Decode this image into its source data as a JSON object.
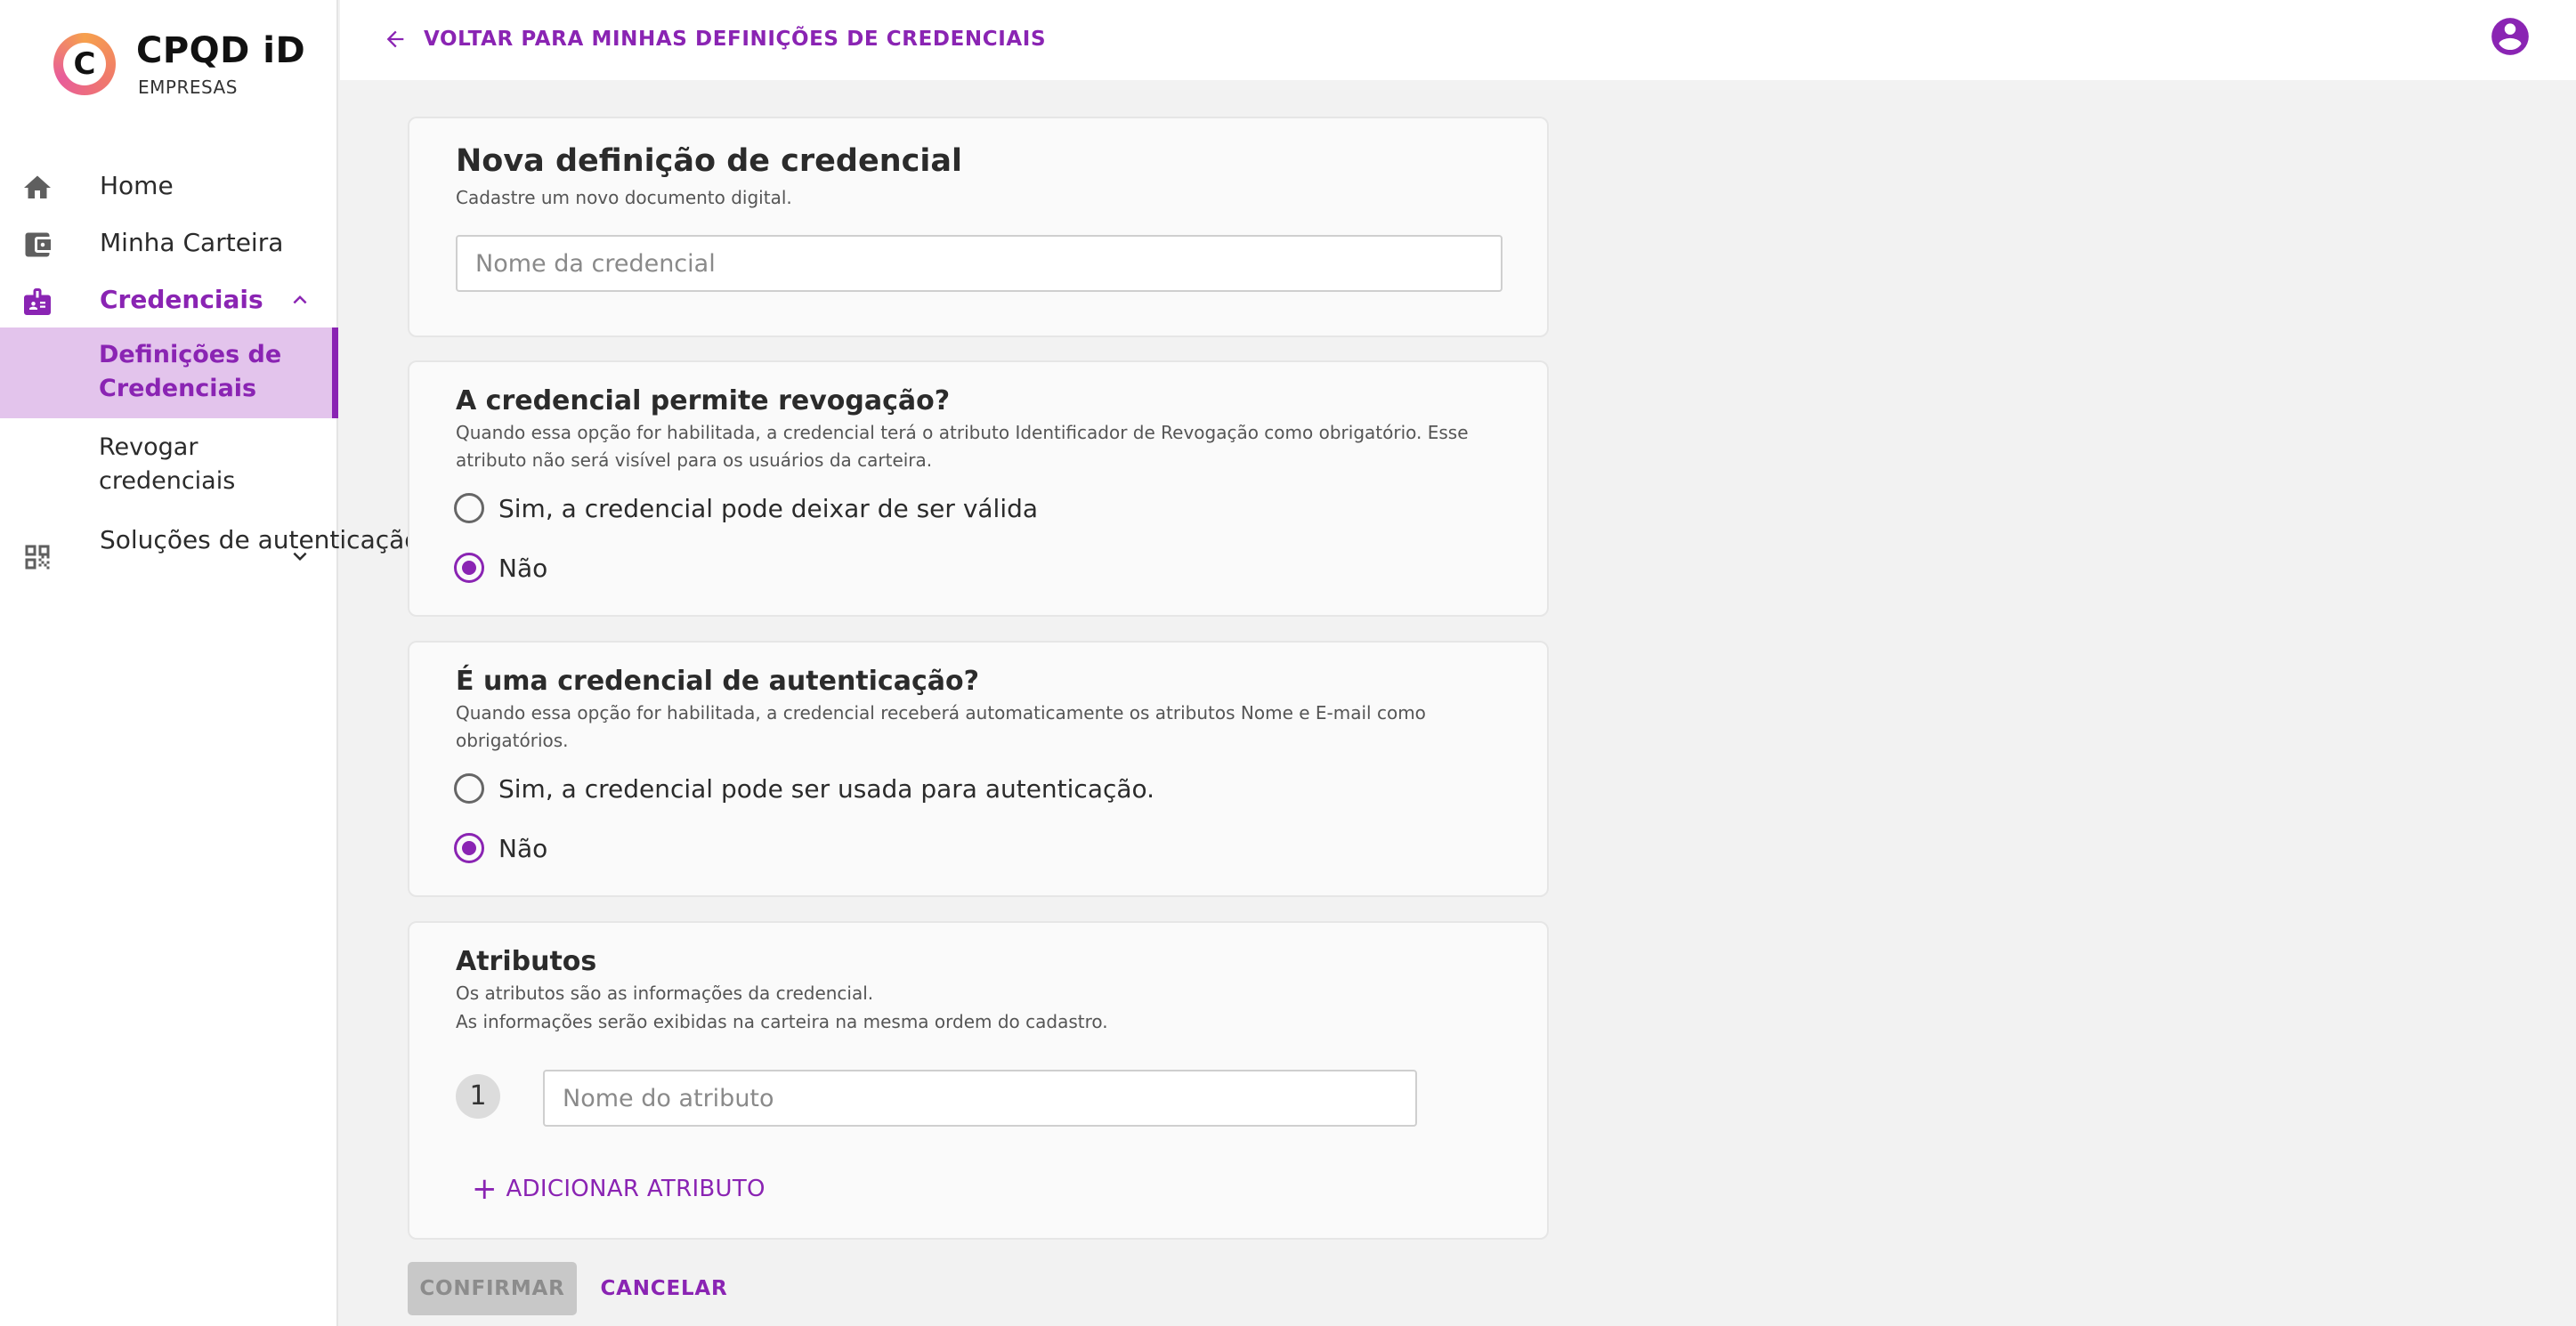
{
  "brand": {
    "title": "CPQD iD",
    "subtitle": "EMPRESAS",
    "logo_icon": "cpqd-logo-icon"
  },
  "sidebar": {
    "items": [
      {
        "label": "Home",
        "icon": "home-icon"
      },
      {
        "label": "Minha Carteira",
        "icon": "wallet-icon"
      },
      {
        "label": "Credenciais",
        "icon": "badge-icon",
        "expanded": true,
        "active": true
      },
      {
        "label": "Soluções de autenticação",
        "icon": "qr-code-icon",
        "expanded": false
      }
    ],
    "subitems": [
      {
        "label": "Definições de Credenciais",
        "selected": true
      },
      {
        "label": "Revogar credenciais",
        "selected": false
      }
    ]
  },
  "header": {
    "back_label": "VOLTAR PARA MINHAS DEFINIÇÕES DE CREDENCIAIS",
    "back_icon": "arrow-left-icon",
    "avatar_icon": "account-circle-icon"
  },
  "form": {
    "title": "Nova definição de credencial",
    "subtitle": "Cadastre um novo documento digital.",
    "name_placeholder": "Nome da credencial",
    "name_value": ""
  },
  "revocation": {
    "title": "A credencial permite revogação?",
    "description": "Quando essa opção for habilitada, a credencial terá o atributo Identificador de Revogação como obrigatório. Esse atributo não será visível para os usuários da carteira.",
    "options": [
      {
        "label": "Sim, a credencial pode deixar de ser válida",
        "checked": false
      },
      {
        "label": "Não",
        "checked": true
      }
    ]
  },
  "authentication": {
    "title": "É uma credencial de autenticação?",
    "description": "Quando essa opção for habilitada, a credencial receberá automaticamente os atributos Nome e E-mail como obrigatórios.",
    "options": [
      {
        "label": "Sim, a credencial pode ser usada para autenticação.",
        "checked": false
      },
      {
        "label": "Não",
        "checked": true
      }
    ]
  },
  "attributes": {
    "title": "Atributos",
    "description_1": "Os atributos são as informações da credencial.",
    "description_2": "As informações serão exibidas na carteira na mesma ordem do cadastro.",
    "rows": [
      {
        "number": "1",
        "placeholder": "Nome do atributo",
        "value": ""
      }
    ],
    "add_label": "ADICIONAR ATRIBUTO",
    "add_symbol": "+"
  },
  "actions": {
    "confirm_label": "CONFIRMAR",
    "confirm_disabled": true,
    "cancel_label": "CANCELAR"
  },
  "colors": {
    "accent": "#8a24b3",
    "accent_light": "#e3c4ec",
    "background": "#f2f2f2",
    "card": "#fafafa",
    "disabled_button": "#c8c8c8"
  }
}
